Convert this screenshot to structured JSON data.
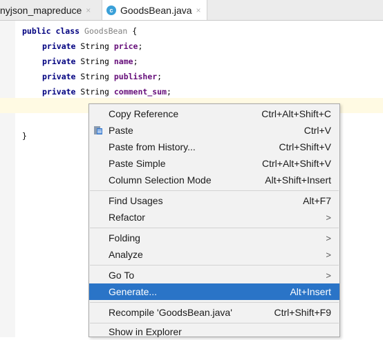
{
  "tabs": [
    {
      "label": "nyjson_mapreduce",
      "close": "×"
    },
    {
      "label": "GoodsBean.java",
      "close": "×",
      "icon": "class-c-icon"
    }
  ],
  "code": {
    "line1": {
      "kw": "public class ",
      "name": "GoodsBean",
      "rest": " {"
    },
    "fields": [
      {
        "kw": "private ",
        "type": "String ",
        "name": "price",
        "end": ";"
      },
      {
        "kw": "private ",
        "type": "String ",
        "name": "name",
        "end": ";"
      },
      {
        "kw": "private ",
        "type": "String ",
        "name": "publisher",
        "end": ";"
      },
      {
        "kw": "private ",
        "type": "String ",
        "name": "comment_sum",
        "end": ";"
      }
    ],
    "close_brace": "}"
  },
  "menu": {
    "copy_reference": {
      "label": "Copy Reference",
      "shortcut": "Ctrl+Alt+Shift+C"
    },
    "paste": {
      "label": "Paste",
      "shortcut": "Ctrl+V"
    },
    "paste_history": {
      "label": "Paste from History...",
      "shortcut": "Ctrl+Shift+V"
    },
    "paste_simple": {
      "label": "Paste Simple",
      "shortcut": "Ctrl+Alt+Shift+V"
    },
    "column_selection": {
      "label": "Column Selection Mode",
      "shortcut": "Alt+Shift+Insert"
    },
    "find_usages": {
      "label": "Find Usages",
      "shortcut": "Alt+F7"
    },
    "refactor": {
      "label": "Refactor",
      "arrow": ">"
    },
    "folding": {
      "label": "Folding",
      "arrow": ">"
    },
    "analyze": {
      "label": "Analyze",
      "arrow": ">"
    },
    "goto": {
      "label": "Go To",
      "arrow": ">"
    },
    "generate": {
      "label": "Generate...",
      "shortcut": "Alt+Insert"
    },
    "recompile": {
      "label": "Recompile 'GoodsBean.java'",
      "shortcut": "Ctrl+Shift+F9"
    },
    "show_explorer": {
      "label": "Show in Explorer"
    }
  },
  "colors": {
    "selection": "#2a74c7",
    "caret_line": "#fffae3",
    "keyword": "#000080",
    "field": "#660e7a"
  }
}
